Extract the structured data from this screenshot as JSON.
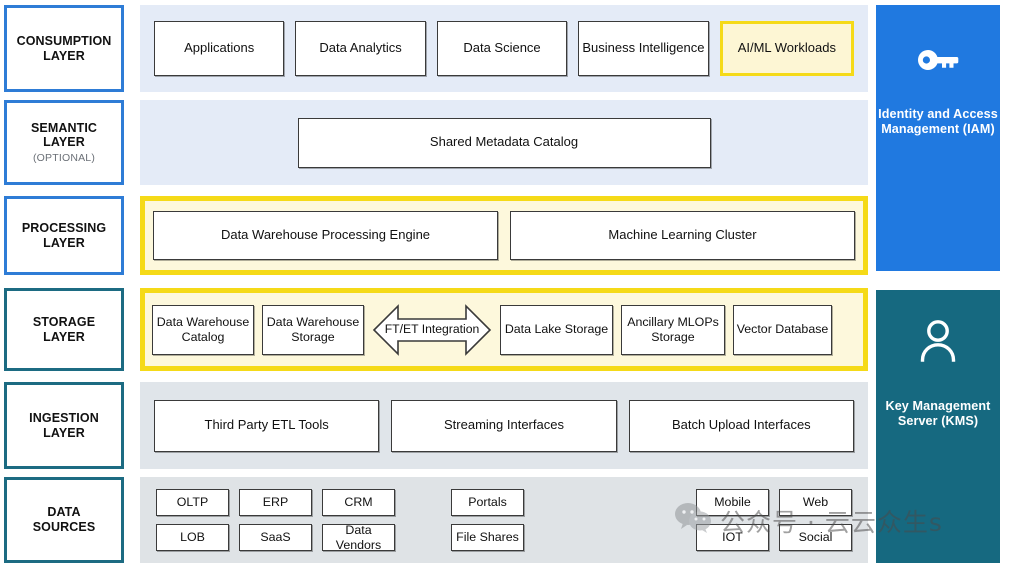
{
  "layer_labels": [
    {
      "title": "CONSUMPTION LAYER",
      "line1": "CONSUMPTION",
      "line2": "LAYER",
      "sub": "",
      "accent": "#2E7CD6"
    },
    {
      "title": "SEMANTIC LAYER",
      "line1": "SEMANTIC",
      "line2": "LAYER",
      "sub": "(OPTIONAL)",
      "accent": "#2E7CD6"
    },
    {
      "title": "PROCESSING LAYER",
      "line1": "PROCESSING",
      "line2": "LAYER",
      "sub": "",
      "accent": "#2E7CD6"
    },
    {
      "title": "STORAGE LAYER",
      "line1": "STORAGE",
      "line2": "LAYER",
      "sub": "",
      "accent": "#1C6B82"
    },
    {
      "title": "INGESTION LAYER",
      "line1": "INGESTION",
      "line2": "LAYER",
      "sub": "",
      "accent": "#1C6B82"
    },
    {
      "title": "DATA SOURCES",
      "line1": "DATA",
      "line2": "SOURCES",
      "sub": "",
      "accent": "#1C6B82"
    }
  ],
  "consumption": {
    "nodes": [
      {
        "label": "Applications"
      },
      {
        "label": "Data Analytics"
      },
      {
        "label": "Data Science"
      },
      {
        "label": "Business Intelligence"
      },
      {
        "label": "AI/ML Workloads"
      }
    ]
  },
  "semantic": {
    "nodes": [
      {
        "label": "Shared Metadata Catalog"
      }
    ]
  },
  "processing": {
    "nodes": [
      {
        "label": "Data Warehouse Processing Engine"
      },
      {
        "label": "Machine Learning Cluster"
      }
    ]
  },
  "storage": {
    "nodes": [
      {
        "label": "Data Warehouse Catalog"
      },
      {
        "label": "Data Warehouse Storage"
      },
      {
        "label": "Data Lake Storage"
      },
      {
        "label": "Ancillary MLOPs Storage"
      },
      {
        "label": "Vector Database"
      }
    ],
    "arrow": {
      "label": "FT/ET Integration",
      "kind": "double-headed-arrow"
    }
  },
  "ingestion": {
    "nodes": [
      {
        "label": "Third Party ETL Tools"
      },
      {
        "label": "Streaming Interfaces"
      },
      {
        "label": "Batch Upload Interfaces"
      }
    ]
  },
  "data_sources": {
    "groups": [
      {
        "name": "enterprise-systems",
        "columns": [
          {
            "top": "OLTP",
            "bottom": "LOB"
          },
          {
            "top": "ERP",
            "bottom": "SaaS"
          },
          {
            "top": "CRM",
            "bottom": "Data Vendors"
          }
        ]
      },
      {
        "name": "content-channels",
        "columns": [
          {
            "top": "Portals",
            "bottom": "File Shares"
          }
        ]
      },
      {
        "name": "digital-channels",
        "columns": [
          {
            "top": "Mobile",
            "bottom": "IOT"
          },
          {
            "top": "Web",
            "bottom": "Social"
          }
        ]
      }
    ]
  },
  "security_panels": [
    {
      "id": "iam",
      "icon": "key-icon",
      "title": "Identity and Access Management (IAM)",
      "color": "#2079e0"
    },
    {
      "id": "kms",
      "icon": "person-icon",
      "title": "Key Management Server (KMS)",
      "color": "#166980"
    }
  ],
  "watermark": {
    "icon": "wechat-icon",
    "text": "公众号 · 云云众生s"
  },
  "colors": {
    "highlight_yellow": "#f5da18",
    "band_blue": "#e4ebf7",
    "band_gray": "#dfe3e6",
    "accent_blue": "#2E7CD6",
    "accent_teal": "#1C6B82"
  }
}
